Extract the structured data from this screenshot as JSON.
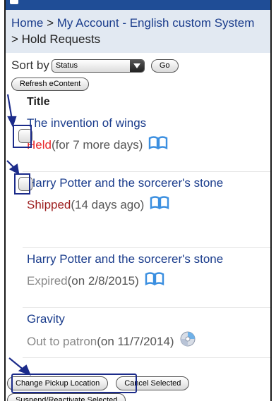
{
  "breadcrumb": {
    "home": "Home",
    "separator1": " > ",
    "my_account": "My Account - English custom System",
    "separator2": " > ",
    "current": "Hold Requests"
  },
  "sort": {
    "label": "Sort by",
    "selected": "Status",
    "go_label": "Go"
  },
  "refresh_label": "Refresh eContent",
  "table": {
    "title_header": "Title"
  },
  "holds": [
    {
      "title": "The invention of wings",
      "status": "Held",
      "detail": " (for 7 more days)",
      "icon": "book-icon"
    },
    {
      "title": "Harry Potter and the sorcerer's stone",
      "status": "Shipped",
      "detail": " (14 days ago)",
      "icon": "book-icon"
    },
    {
      "title": "Harry Potter and the sorcerer's stone",
      "status": "Expired",
      "detail": " (on 2/8/2015)",
      "icon": "book-icon"
    },
    {
      "title": "Gravity",
      "status": "Out to patron",
      "detail": " (on 11/7/2014)",
      "icon": "disc-icon"
    }
  ],
  "actions": {
    "change_pickup": "Change Pickup Location",
    "cancel_selected": "Cancel Selected",
    "suspend_reactivate": "Suspend/Reactivate Selected"
  },
  "colors": {
    "header_bar": "#1f4d96",
    "link": "#1a3c8c",
    "held": "#e8282a",
    "shipped": "#9c1d1d",
    "annotation": "#1b2b8a"
  }
}
